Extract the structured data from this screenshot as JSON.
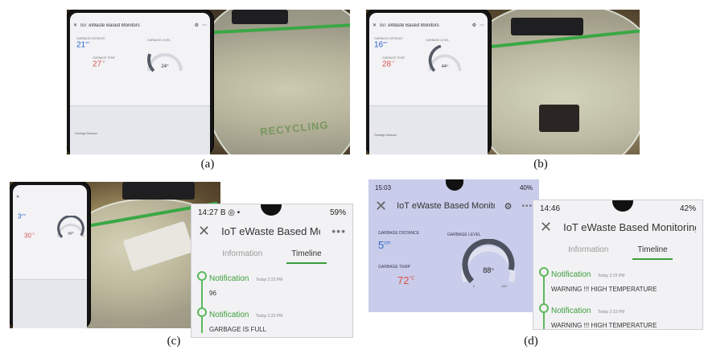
{
  "panels": {
    "a": {
      "caption": "(a)",
      "phone": {
        "app_title": "IoT eWaste Based Monitors",
        "garbage_distance_label": "GARBAGE DISTANCE",
        "garbage_distance_value": "21",
        "garbage_distance_unit": "cm",
        "garbage_temp_label": "GARBAGE TEMP",
        "garbage_temp_value": "27",
        "garbage_temp_unit": "°C",
        "garbage_level_label": "GARBAGE LEVEL",
        "garbage_level_value": "24",
        "garbage_level_unit": "%",
        "chart_label": "Garbage Distance",
        "bin_text": "RECYCLING"
      }
    },
    "b": {
      "caption": "(b)",
      "phone": {
        "app_title": "IoT eWaste Based Monitors",
        "garbage_distance_label": "GARBAGE DISTANCE",
        "garbage_distance_value": "16",
        "garbage_distance_unit": "cm",
        "garbage_temp_label": "GARBAGE TEMP",
        "garbage_temp_value": "28",
        "garbage_temp_unit": "°C",
        "garbage_level_label": "GARBAGE LEVEL",
        "garbage_level_value": "44",
        "garbage_level_unit": "%",
        "chart_label": "Garbage Distance"
      }
    },
    "c": {
      "caption": "(c)",
      "phone": {
        "garbage_distance_value": "3",
        "garbage_distance_unit": "cm",
        "garbage_temp_value": "30",
        "garbage_temp_unit": "°C",
        "garbage_level_value": "96",
        "garbage_level_unit": "%"
      },
      "screen": {
        "status_time": "14:27",
        "status_icons_left": "B ◎ •",
        "status_right": "59%",
        "app_title": "IoT eWaste Based Monitoring Sy:",
        "tab_information": "Information",
        "tab_timeline": "Timeline",
        "items": [
          {
            "title": "Notification",
            "time": "Today 2:23 PM",
            "message": "96"
          },
          {
            "title": "Notification",
            "time": "Today 2:23 PM",
            "message": "GARBAGE IS FULL"
          }
        ]
      }
    },
    "d": {
      "caption": "(d)",
      "dashboard": {
        "status_time": "15:03",
        "status_right": "40%",
        "app_title": "IoT eWaste Based Monitori",
        "garbage_distance_label": "GARBAGE DISTANCE",
        "garbage_distance_value": "5",
        "garbage_distance_unit": "cm",
        "garbage_temp_label": "GARBAGE TEMP",
        "garbage_temp_value": "72",
        "garbage_temp_unit": "°C",
        "garbage_level_label": "GARBAGE LEVEL",
        "garbage_level_value": "88",
        "garbage_level_unit": "%",
        "gauge_min": "0",
        "gauge_max": "100"
      },
      "screen": {
        "status_time": "14:46",
        "status_right": "42%",
        "app_title": "IoT eWaste Based Monitoring Sy:",
        "tab_information": "Information",
        "tab_timeline": "Timeline",
        "items": [
          {
            "title": "Notification",
            "time": "Today 2:23 PM",
            "message": "WARNING !!! HIGH TEMPERATURE"
          },
          {
            "title": "Notification",
            "time": "Today 2:23 PM",
            "message": "WARNING !!! HIGH TEMPERATURE"
          }
        ]
      }
    }
  },
  "colors": {
    "accent_green": "#5cb85c",
    "value_blue": "#2a5fc4",
    "value_red": "#d9534f",
    "gauge_gray": "#555a66"
  }
}
